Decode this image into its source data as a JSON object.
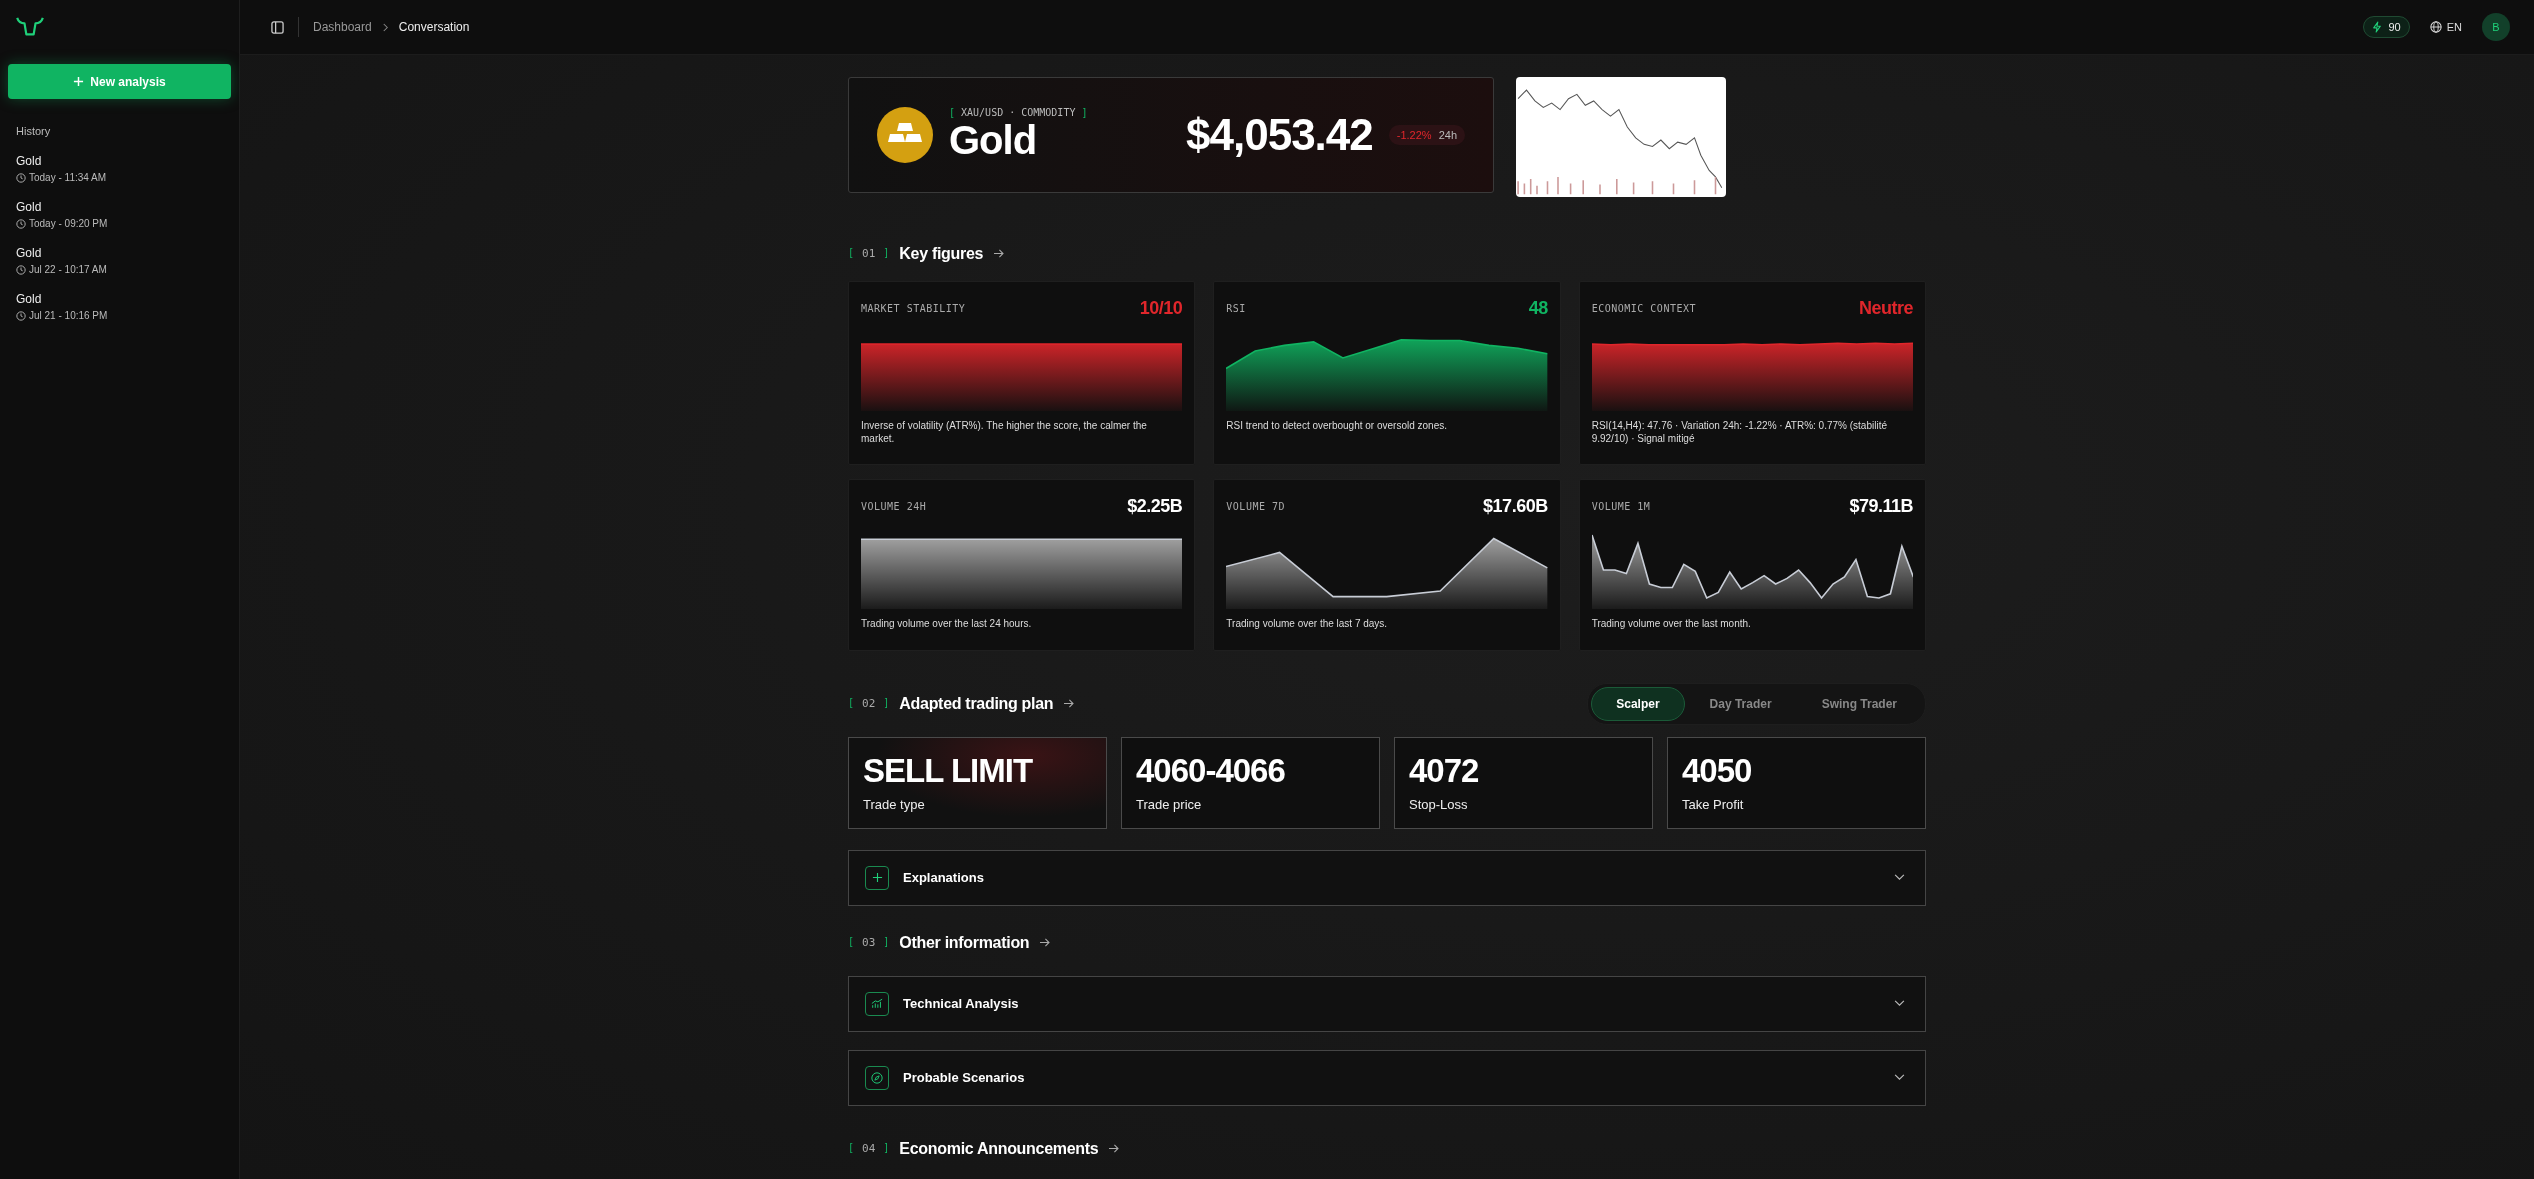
{
  "sidebar": {
    "new_button": "New analysis",
    "history_title": "History",
    "history": [
      {
        "title": "Gold",
        "time": "Today - 11:34 AM"
      },
      {
        "title": "Gold",
        "time": "Today - 09:20 PM"
      },
      {
        "title": "Gold",
        "time": "Jul 22 - 10:17 AM"
      },
      {
        "title": "Gold",
        "time": "Jul 21 - 10:16 PM"
      }
    ]
  },
  "topbar": {
    "breadcrumb": [
      "Dashboard",
      "Conversation"
    ],
    "credits": "90",
    "language": "EN",
    "avatar": "B"
  },
  "asset": {
    "brackets": [
      "[",
      "]"
    ],
    "tag": "XAU/USD · COMMODITY",
    "name": "Gold",
    "price": "$4,053.42",
    "change": "-1.22%",
    "period": "24h"
  },
  "key_figures": {
    "brackets": [
      "[",
      "]"
    ],
    "number": "01",
    "title": "Key figures",
    "metrics": [
      {
        "label": "MARKET STABILITY",
        "value": "10/10",
        "color": "#e0262b",
        "description": "Inverse of volatility (ATR%). The higher the score, the calmer the market."
      },
      {
        "label": "RSI",
        "value": "48",
        "color": "#10b462",
        "description": "RSI trend to detect overbought or oversold zones."
      },
      {
        "label": "ECONOMIC CONTEXT",
        "value": "Neutre",
        "color": "#e0262b",
        "description": "RSI(14,H4): 47.76 · Variation 24h: -1.22% · ATR%: 0.77% (stabilité 9.92/10) · Signal mitigé"
      },
      {
        "label": "VOLUME 24H",
        "value": "$2.25B",
        "color": "#ffffff",
        "description": "Trading volume over the last 24 hours."
      },
      {
        "label": "VOLUME 7D",
        "value": "$17.60B",
        "color": "#ffffff",
        "description": "Trading volume over the last 7 days."
      },
      {
        "label": "VOLUME 1M",
        "value": "$79.11B",
        "color": "#ffffff",
        "description": "Trading volume over the last month."
      }
    ]
  },
  "trading_plan": {
    "brackets": [
      "[",
      "]"
    ],
    "number": "02",
    "title": "Adapted trading plan",
    "modes": [
      {
        "label": "Scalper",
        "selected": true
      },
      {
        "label": "Day Trader",
        "selected": false
      },
      {
        "label": "Swing Trader",
        "selected": false
      }
    ],
    "cards": [
      {
        "value": "SELL LIMIT",
        "label": "Trade type"
      },
      {
        "value": "4060-4066",
        "label": "Trade price"
      },
      {
        "value": "4072",
        "label": "Stop-Loss"
      },
      {
        "value": "4050",
        "label": "Take Profit"
      }
    ],
    "explanations": {
      "title": "Explanations",
      "expanded": false
    }
  },
  "other_information": {
    "brackets": [
      "[",
      "]"
    ],
    "number": "03",
    "title": "Other information",
    "panels": [
      {
        "title": "Technical Analysis",
        "expanded": false
      },
      {
        "title": "Probable Scenarios",
        "expanded": false
      }
    ]
  },
  "economic_announcements": {
    "brackets": [
      "[",
      "]"
    ],
    "number": "04",
    "title": "Economic Announcements"
  }
}
